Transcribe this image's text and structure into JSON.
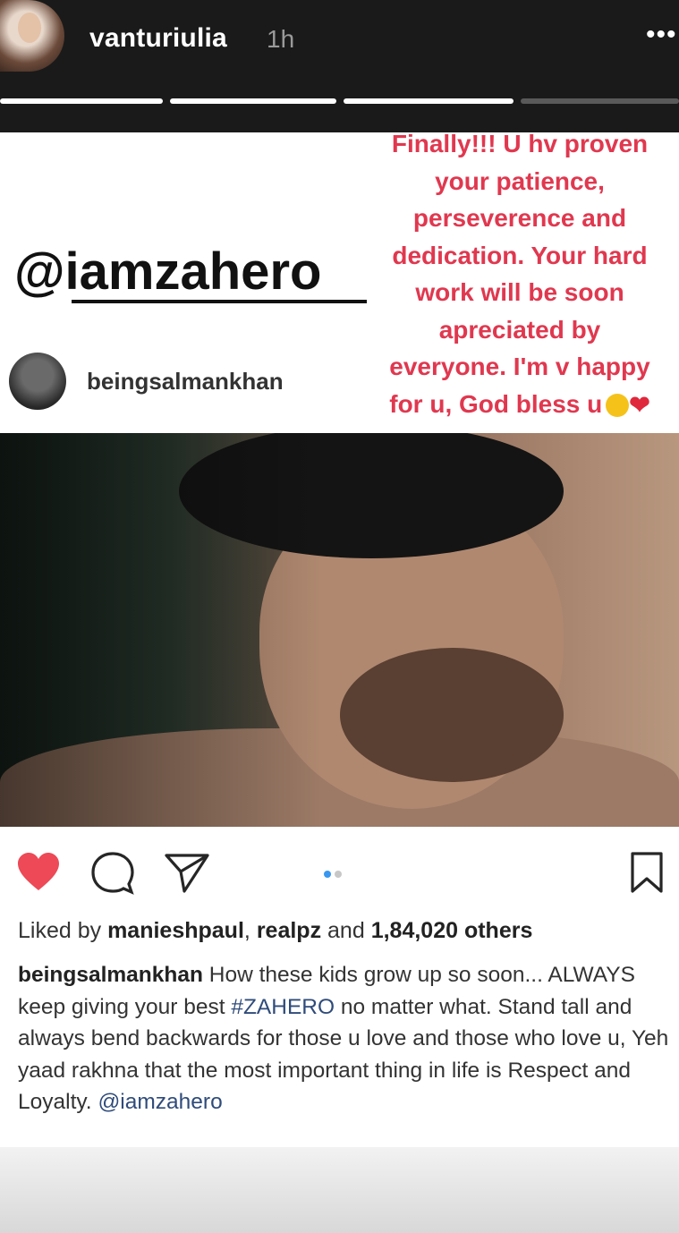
{
  "story": {
    "username": "vanturiulia",
    "time": "1h",
    "more_label": "•••",
    "progress_segments": 4
  },
  "sticker": {
    "mention": "@iamzahero"
  },
  "story_text": {
    "lines": [
      "Finally!!! U hv proven",
      "your patience,",
      "perseverence and",
      "dedication. Your hard",
      "work will be soon",
      "apreciated by",
      "everyone. I'm v happy",
      "for u, God bless u"
    ]
  },
  "post": {
    "username": "beingsalmankhan",
    "likes_prefix": "Liked by",
    "liked_user1": "manieshpaul",
    "separator": ",",
    "liked_user2": "realpz",
    "and_label": "and",
    "others": "1,84,020 others",
    "caption_user": "beingsalmankhan",
    "caption_part1": "How these kids grow up so soon... ALWAYS keep giving your best",
    "hashtag": "#ZAHERO",
    "caption_part2": "no matter what. Stand tall and always bend backwards for those u love and those who love u, Yeh yaad rakhna that the most important thing in life is Respect and Loyalty.",
    "mention": "@iamzahero"
  },
  "colors": {
    "story_bg": "#1a1a1a",
    "red_text": "#e0384f",
    "heart": "#ed4956",
    "tag": "#2f4b7a"
  }
}
